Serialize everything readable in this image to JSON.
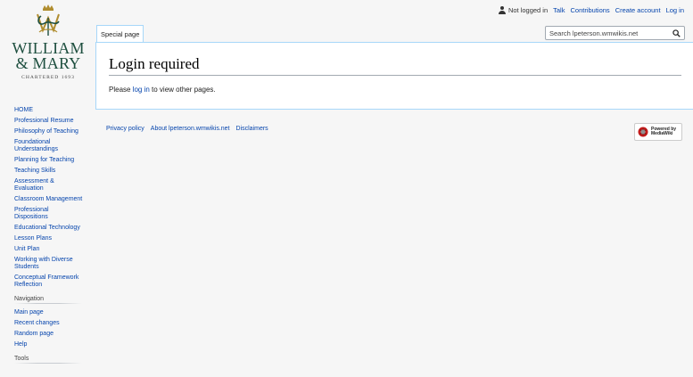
{
  "personal": {
    "status": "Not logged in",
    "links": [
      "Talk",
      "Contributions",
      "Create account",
      "Log in"
    ]
  },
  "logo": {
    "line1": "WILLIAM",
    "line2": "& MARY",
    "subtitle": "CHARTERED 1693"
  },
  "tabs": [
    "Special page"
  ],
  "search": {
    "placeholder": "Search lpeterson.wmwikis.net"
  },
  "content": {
    "title": "Login required",
    "text_before": "Please ",
    "link": "log in",
    "text_after": " to view other pages."
  },
  "sidebar": {
    "main_items": [
      "HOME",
      "Professional Resume",
      "Philosophy of Teaching",
      "Foundational Understandings",
      "Planning for Teaching",
      "Teaching Skills",
      "Assessment & Evaluation",
      "Classroom Management",
      "Professional Dispositions",
      "Educational Technology",
      "Lesson Plans",
      "Unit Plan",
      "Working with Diverse Students",
      "Conceptual Framework Reflection"
    ],
    "navigation_heading": "Navigation",
    "navigation_items": [
      "Main page",
      "Recent changes",
      "Random page",
      "Help"
    ],
    "tools_heading": "Tools"
  },
  "footer": {
    "links": [
      "Privacy policy",
      "About lpeterson.wmwikis.net",
      "Disclaimers"
    ]
  },
  "powered_by": {
    "line1": "Powered by",
    "line2": "MediaWiki"
  },
  "colors": {
    "link": "#0645ad",
    "border": "#a7d7f9",
    "background": "#f6f6f6",
    "logo_green": "#1e4f3f"
  }
}
